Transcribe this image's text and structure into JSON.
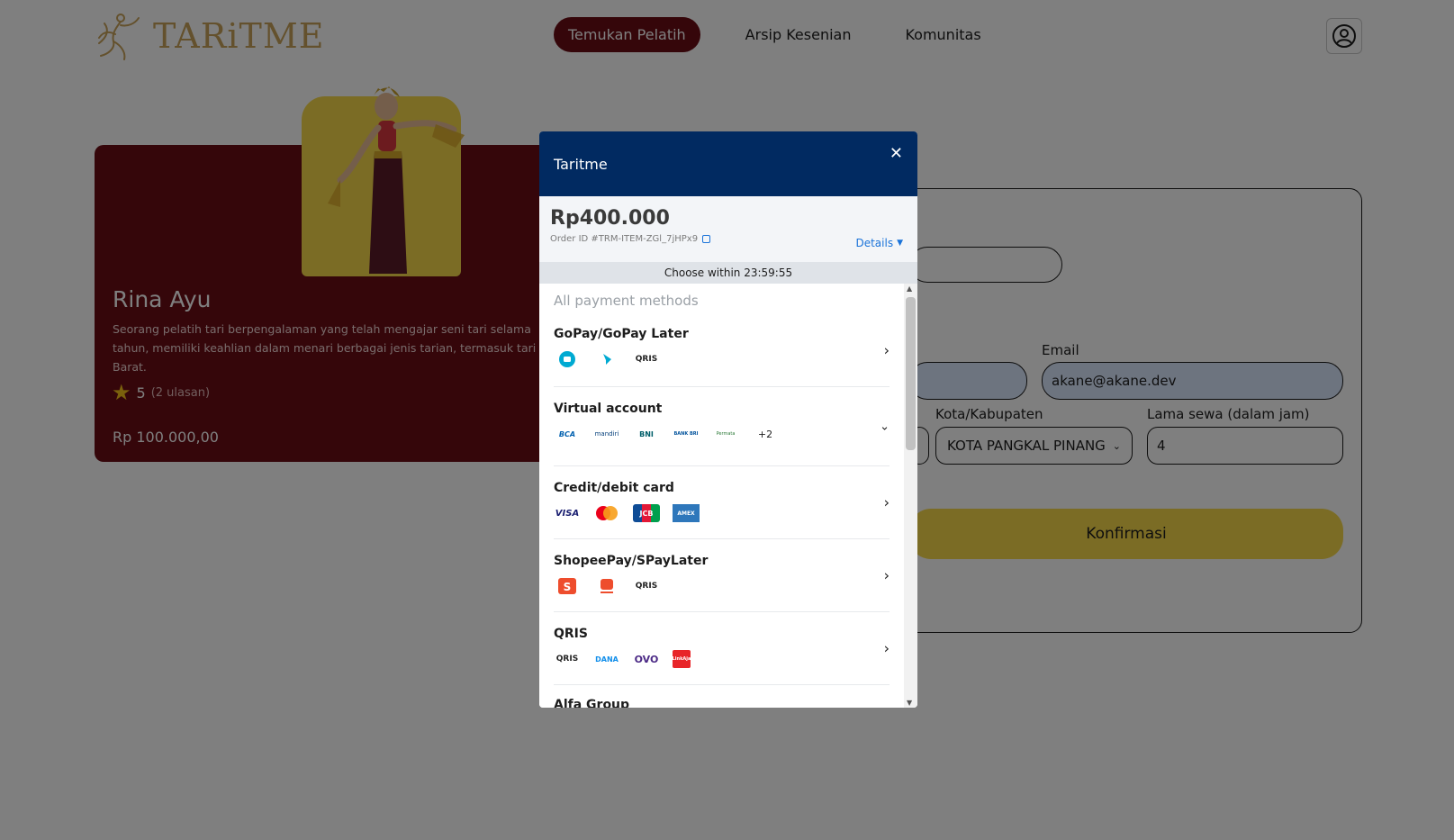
{
  "brand": {
    "logo_text": "TARiTME"
  },
  "nav": {
    "items": [
      {
        "label": "Temukan Pelatih"
      },
      {
        "label": "Arsip Kesenian"
      },
      {
        "label": "Komunitas"
      }
    ]
  },
  "trainer": {
    "name": "Rina Ayu",
    "description": "Seorang pelatih tari berpengalaman yang telah mengajar seni tari selama tahun, memiliki keahlian dalam menari berbagai jenis tarian, termasuk tari Barat.",
    "rating": "5",
    "review_count": "(2 ulasan)",
    "price": "Rp 100.000,00"
  },
  "form": {
    "email_label": "Email",
    "email_value": "akane@akane.dev",
    "city_label": "Kota/Kabupaten",
    "city_value": "KOTA PANGKAL PINANG",
    "hours_label": "Lama sewa (dalam jam)",
    "hours_value": "4",
    "confirm_label": "Konfirmasi"
  },
  "payment": {
    "title": "Taritme",
    "amount": "Rp400.000",
    "order_id": "Order ID #TRM-ITEM-ZGl_7jHPx9",
    "details_label": "Details",
    "timer": "Choose within 23:59:55",
    "heading": "All payment methods",
    "methods": [
      {
        "name": "GoPay/GoPay Later",
        "logos": [
          "gopay",
          "gopay-later",
          "qris"
        ],
        "extra": ""
      },
      {
        "name": "Virtual account",
        "logos": [
          "BCA",
          "mandiri",
          "BNI",
          "BANK BRI",
          "Permata"
        ],
        "extra": "+2"
      },
      {
        "name": "Credit/debit card",
        "logos": [
          "VISA",
          "mastercard",
          "JCB",
          "AMEX"
        ],
        "extra": ""
      },
      {
        "name": "ShopeePay/SPayLater",
        "logos": [
          "shopeepay",
          "spaylater",
          "qris"
        ],
        "extra": ""
      },
      {
        "name": "QRIS",
        "logos": [
          "qris",
          "DANA",
          "OVO",
          "LinkAja"
        ],
        "extra": ""
      },
      {
        "name": "Alfa Group",
        "logos": [],
        "extra": ""
      }
    ]
  },
  "colors": {
    "maroon": "#6b0d15",
    "navy": "#012a61",
    "gold": "#f7d84a",
    "link_blue": "#1a73d9"
  }
}
